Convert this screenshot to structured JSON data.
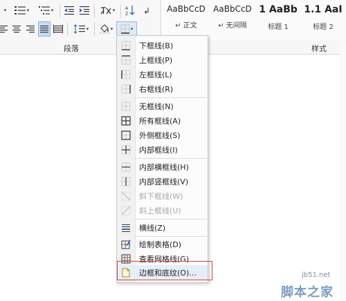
{
  "ribbon": {
    "paragraph_group_label": "段落",
    "styles_group_label": "样式",
    "styles": [
      {
        "sample": "AaBbCcD",
        "name": "↵ 正文"
      },
      {
        "sample": "AaBbCcD",
        "name": "↵ 无间隔"
      },
      {
        "sample": "1 AaBb",
        "name": "标题 1"
      },
      {
        "sample": "1.1 AaI",
        "name": "标题 2"
      }
    ]
  },
  "border_menu": {
    "items": [
      {
        "label": "下框线(B)",
        "icon": "border-bottom-icon",
        "enabled": true
      },
      {
        "label": "上框线(P)",
        "icon": "border-top-icon",
        "enabled": true
      },
      {
        "label": "左框线(L)",
        "icon": "border-left-icon",
        "enabled": true
      },
      {
        "label": "右框线(R)",
        "icon": "border-right-icon",
        "enabled": true
      },
      {
        "label": "无框线(N)",
        "icon": "border-none-icon",
        "enabled": true
      },
      {
        "label": "所有框线(A)",
        "icon": "border-all-icon",
        "enabled": true
      },
      {
        "label": "外侧框线(S)",
        "icon": "border-outside-icon",
        "enabled": true
      },
      {
        "label": "内部框线(I)",
        "icon": "border-inside-icon",
        "enabled": true
      },
      {
        "label": "内部横框线(H)",
        "icon": "border-inside-horizontal-icon",
        "enabled": true
      },
      {
        "label": "内部竖框线(V)",
        "icon": "border-inside-vertical-icon",
        "enabled": true
      },
      {
        "label": "斜下框线(W)",
        "icon": "border-diagonal-down-icon",
        "enabled": false
      },
      {
        "label": "斜上框线(U)",
        "icon": "border-diagonal-up-icon",
        "enabled": false
      },
      {
        "label": "横线(Z)",
        "icon": "horizontal-line-icon",
        "enabled": true
      },
      {
        "label": "绘制表格(D)",
        "icon": "draw-table-icon",
        "enabled": true
      },
      {
        "label": "查看网格线(G)",
        "icon": "view-gridlines-icon",
        "enabled": true
      },
      {
        "label": "边框和底纹(O)...",
        "icon": "borders-shading-icon",
        "enabled": true
      }
    ],
    "highlight_color": "#d9413c"
  },
  "watermark": {
    "site": "jb51.net",
    "text": "脚本之家"
  }
}
